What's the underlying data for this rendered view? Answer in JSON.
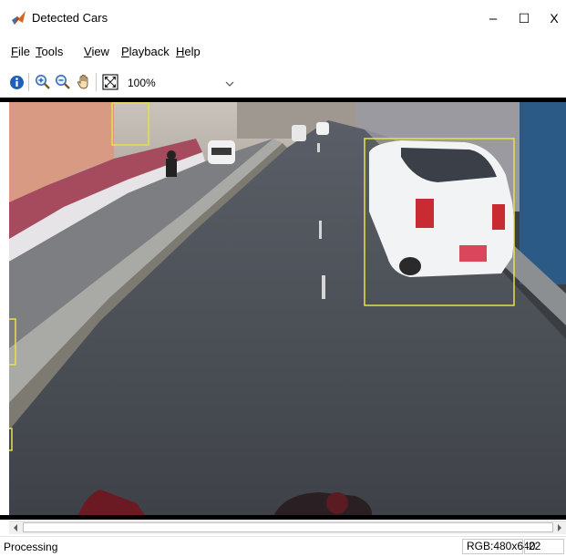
{
  "window": {
    "title": "Detected Cars",
    "controls": {
      "minimize": "–",
      "maximize": "☐",
      "close": "X"
    }
  },
  "menu": {
    "items": [
      {
        "accel": "F",
        "rest": "ile"
      },
      {
        "accel": "T",
        "rest": "ools"
      },
      {
        "accel": "V",
        "rest": "iew"
      },
      {
        "accel": "P",
        "rest": "layback"
      },
      {
        "accel": "H",
        "rest": "elp"
      }
    ]
  },
  "toolbar": {
    "icons": [
      "info-icon",
      "zoom-in-icon",
      "zoom-out-icon",
      "pan-hand-icon",
      "fit-to-window-icon"
    ],
    "zoom": {
      "value": "100%",
      "caret": "⌵"
    }
  },
  "viewport": {
    "detection_color": "#e8e04a",
    "detections_count": 4
  },
  "statusbar": {
    "status": "Processing",
    "image_info": "RGB:480x640",
    "frame": "22"
  }
}
